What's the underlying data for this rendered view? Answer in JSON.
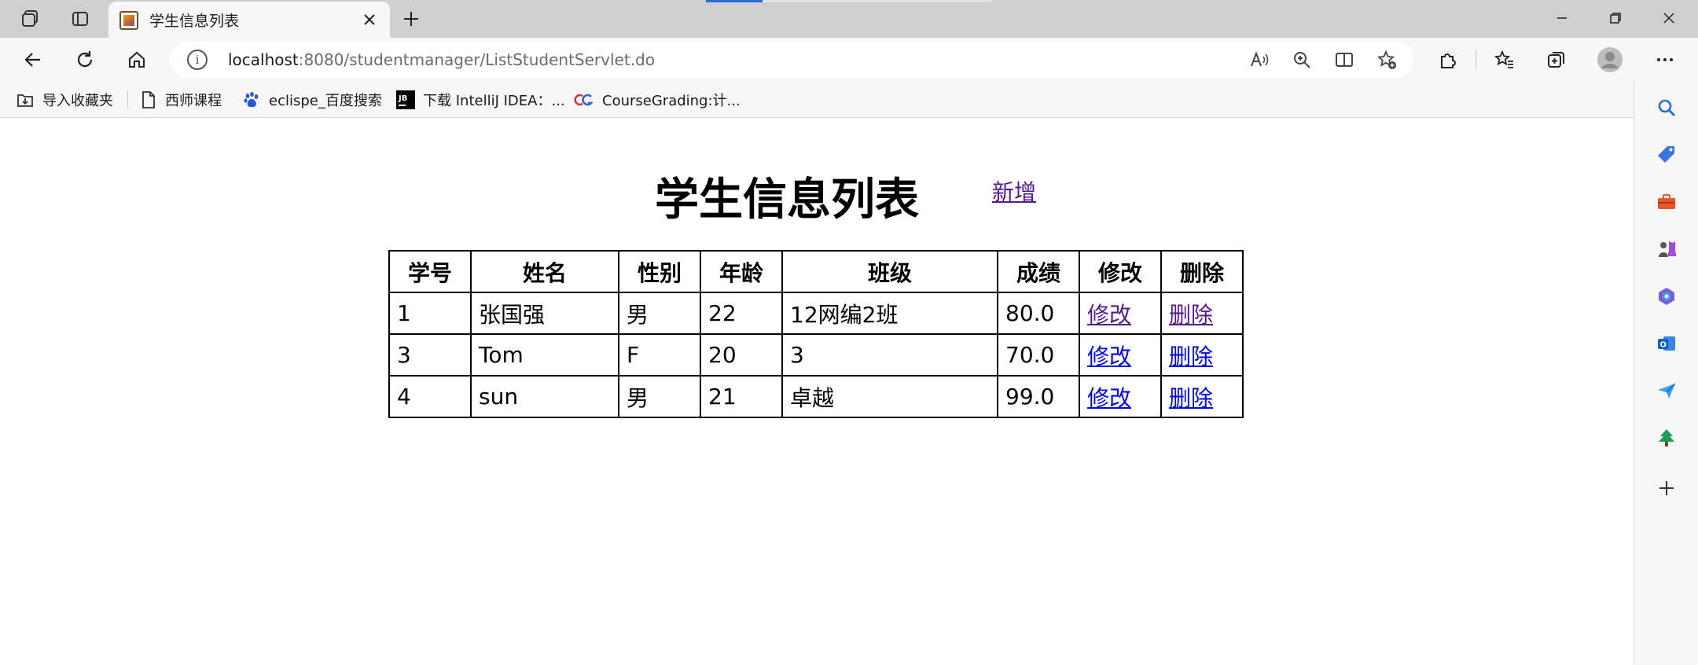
{
  "browser": {
    "tab": {
      "title": "学生信息列表"
    },
    "address": {
      "host": "localhost",
      "path": ":8080/studentmanager/ListStudentServlet.do"
    },
    "favorites": [
      {
        "label": "导入收藏夹",
        "icon": "import-favorites-icon"
      },
      {
        "label": "西师课程",
        "icon": "document-icon"
      },
      {
        "label": "eclispe_百度搜索",
        "icon": "baidu-paw-icon"
      },
      {
        "label": "下载 IntelliJ IDEA：...",
        "icon": "jetbrains-icon"
      },
      {
        "label": "CourseGrading:计...",
        "icon": "coursegrading-icon"
      }
    ]
  },
  "page": {
    "title": "学生信息列表",
    "add_link": "新增",
    "table": {
      "headers": [
        "学号",
        "姓名",
        "性别",
        "年龄",
        "班级",
        "成绩",
        "修改",
        "删除"
      ],
      "rows": [
        {
          "id": "1",
          "name": "张国强",
          "gender": "男",
          "age": "22",
          "class": "12网编2班",
          "score": "80.0",
          "edit": "修改",
          "delete": "删除"
        },
        {
          "id": "3",
          "name": "Tom",
          "gender": "F",
          "age": "20",
          "class": "3",
          "score": "70.0",
          "edit": "修改",
          "delete": "删除"
        },
        {
          "id": "4",
          "name": "sun",
          "gender": "男",
          "age": "21",
          "class": "卓越",
          "score": "99.0",
          "edit": "修改",
          "delete": "删除"
        }
      ]
    }
  },
  "colors": {
    "visited_link": "#551a8b",
    "link": "#0000ee",
    "tab_progress": "#2b6fd6"
  }
}
